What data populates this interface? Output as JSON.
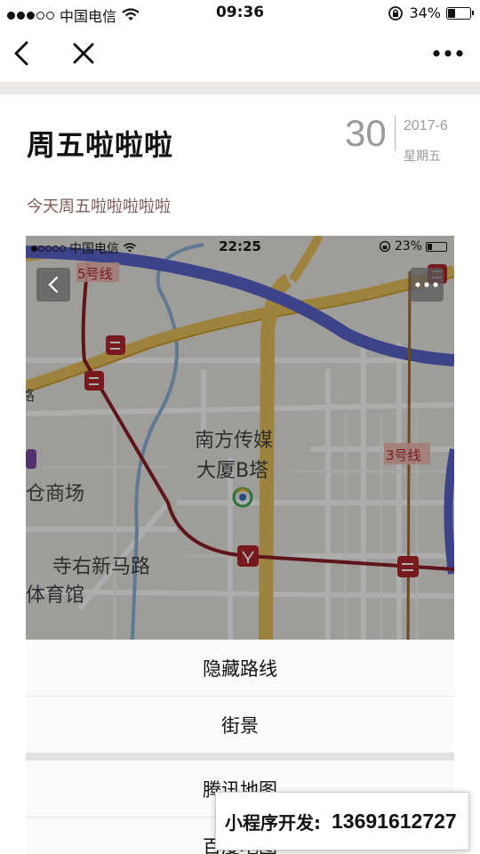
{
  "status_bar": {
    "carrier": "中国电信",
    "time": "09:36",
    "battery_text": "34%",
    "battery_level": 0.34
  },
  "nav": {
    "back_icon": "back-chevron-icon",
    "close_icon": "close-icon",
    "more_icon": "more-dots-icon"
  },
  "article": {
    "title": "周五啦啦啦",
    "day": "30",
    "year_month": "2017-6",
    "weekday": "星期五",
    "subtitle": "今天周五啦啦啦啦啦"
  },
  "embedded_screenshot": {
    "status_bar": {
      "carrier": "中国电信",
      "time": "22:25",
      "battery_text": "23%",
      "battery_level": 0.23
    },
    "map": {
      "line_5_label": "5号线",
      "line_3_label": "3号线",
      "building_label_1": "南方传媒",
      "building_label_2": "大厦B塔",
      "place_mall": "仓商场",
      "place_road": "寺右新马路",
      "place_stadium": "体育馆",
      "left_cut_text": "路"
    },
    "action_sheet": {
      "items": [
        "隐藏路线",
        "街景",
        "腾讯地图",
        "百度地图"
      ]
    }
  },
  "promo": {
    "label": "小程序开发:",
    "phone": "13691612727"
  },
  "colors": {
    "separator": "#ede8e3",
    "date_gray": "#9a9a9a",
    "subtitle": "#7a5a55",
    "road_yellow": "#e8c15a",
    "highway_blue": "#5b63c9",
    "metro_red": "#8b1e24"
  }
}
